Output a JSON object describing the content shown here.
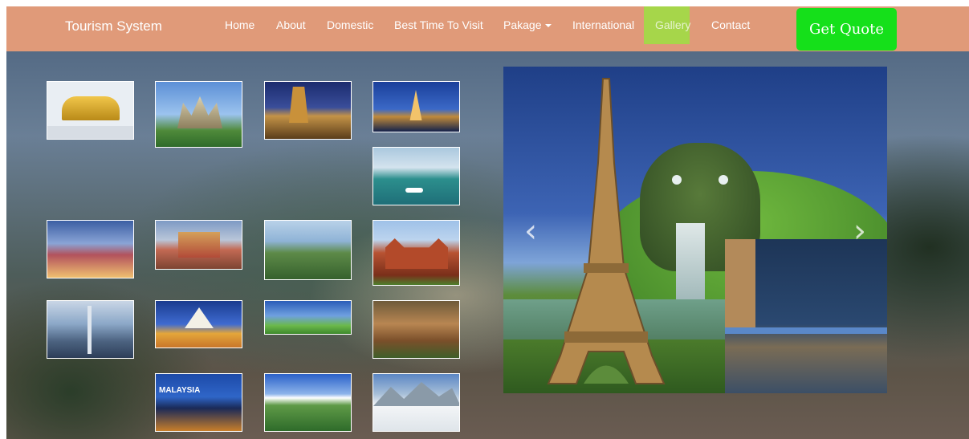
{
  "navbar": {
    "brand": "Tourism System",
    "items": [
      {
        "label": "Home"
      },
      {
        "label": "About"
      },
      {
        "label": "Domestic"
      },
      {
        "label": "Best Time To Visit"
      },
      {
        "label": "Pakage"
      },
      {
        "label": "International"
      },
      {
        "label": "Gallery",
        "active": true
      },
      {
        "label": "Contact"
      }
    ],
    "quote_button": "Get Quote"
  },
  "gallery": {
    "thumbnail_captions": {
      "malaysia": "MALAYSIA"
    }
  },
  "carousel": {
    "prev_icon": "chevron-left-icon",
    "next_icon": "chevron-right-icon",
    "prev_glyph": "‹",
    "next_glyph": "›"
  },
  "colors": {
    "navbar_bg": "#e09a79",
    "active_nav_bg": "#a6d64a",
    "quote_button_bg": "#15e01a",
    "text": "#ffffff"
  }
}
